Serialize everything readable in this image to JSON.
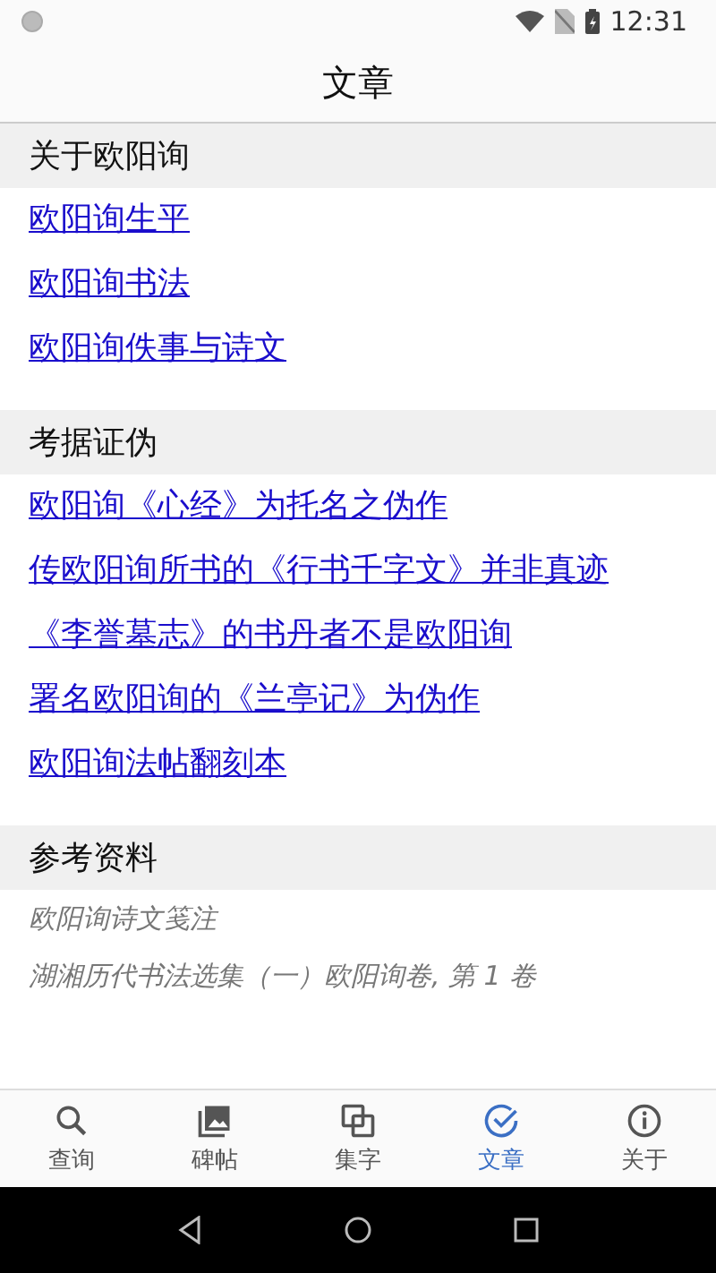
{
  "status_bar": {
    "time": "12:31"
  },
  "title": "文章",
  "sections": [
    {
      "heading": "关于欧阳询",
      "kind": "links",
      "items": [
        "欧阳询生平",
        "欧阳询书法",
        "欧阳询佚事与诗文"
      ]
    },
    {
      "heading": "考据证伪",
      "kind": "links",
      "items": [
        "欧阳询《心经》为托名之伪作",
        "传欧阳询所书的《行书千字文》并非真迹",
        "《李誉墓志》的书丹者不是欧阳询",
        "署名欧阳询的《兰亭记》为伪作",
        "欧阳询法帖翻刻本"
      ]
    },
    {
      "heading": "参考资料",
      "kind": "references",
      "items": [
        "欧阳询诗文笺注",
        "湖湘历代书法选集（一）欧阳询卷, 第 1 卷"
      ]
    }
  ],
  "bottom_nav": [
    {
      "label": "查询",
      "kind": "search",
      "selected": false
    },
    {
      "label": "碑帖",
      "kind": "image",
      "selected": false
    },
    {
      "label": "集字",
      "kind": "copy",
      "selected": false
    },
    {
      "label": "文章",
      "kind": "check",
      "selected": true
    },
    {
      "label": "关于",
      "kind": "info",
      "selected": false
    }
  ]
}
